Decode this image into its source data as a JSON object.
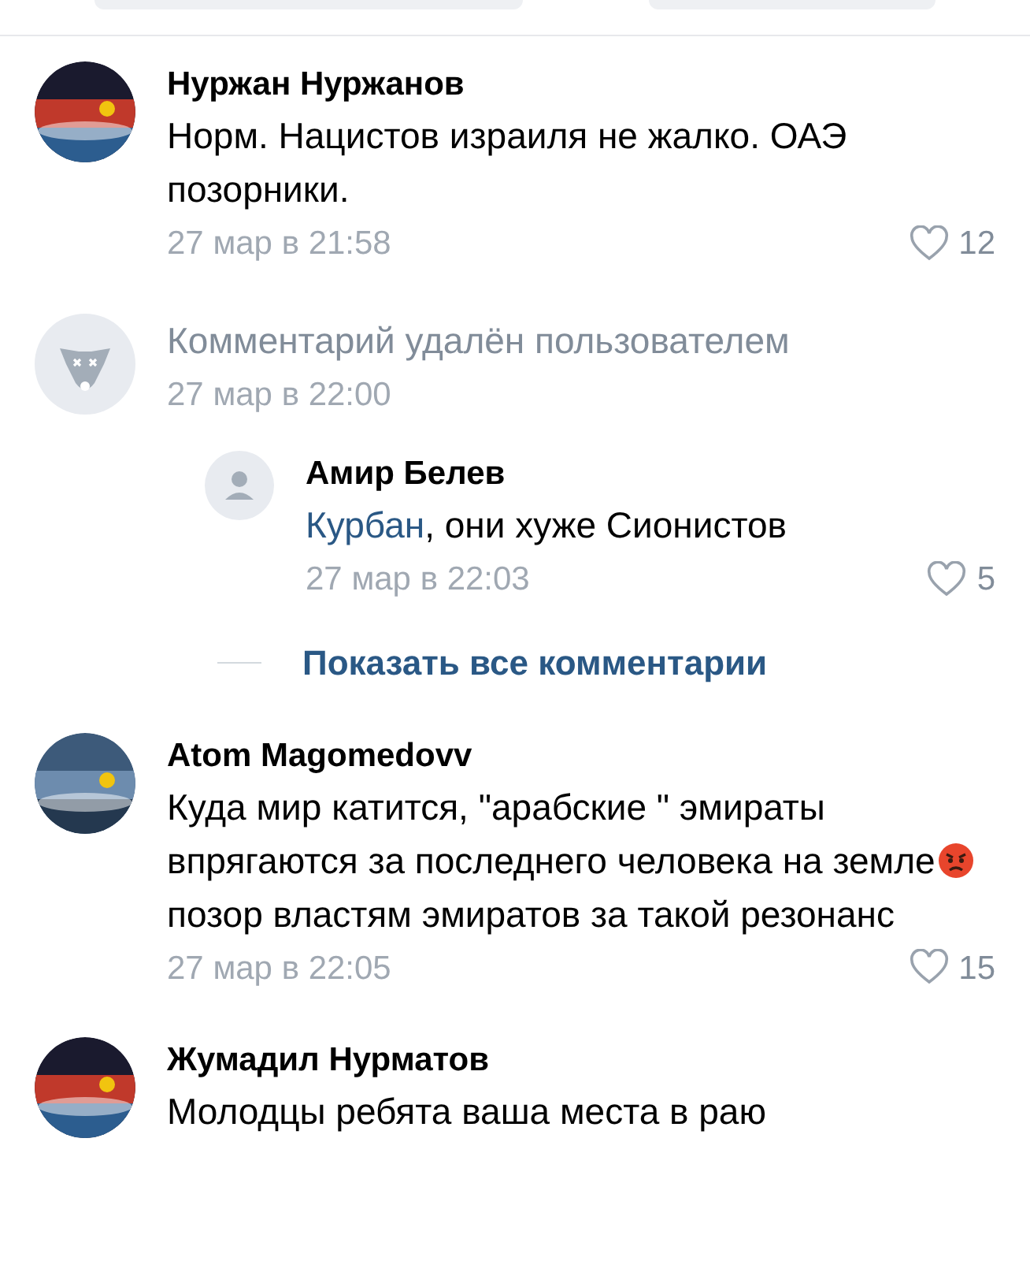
{
  "comments": [
    {
      "kind": "normal",
      "avatar": {
        "kind": "picture"
      },
      "author": "Нуржан Нуржанов",
      "body": [
        {
          "kind": "text",
          "text": "Норм. Нацистов израиля не жалко. ОАЭ позорники."
        }
      ],
      "date": "27 мар в 21:58",
      "likes": "12",
      "liked": false
    },
    {
      "kind": "deleted",
      "avatar": {
        "kind": "deleted"
      },
      "body": [
        {
          "kind": "text",
          "text": "Комментарий удалён пользователем"
        }
      ],
      "date": "27 мар в 22:00",
      "replies": [
        {
          "avatar": {
            "kind": "default"
          },
          "author": "Амир Белев",
          "mention": "Курбан",
          "body": [
            {
              "kind": "text",
              "text": ", они хуже Сионистов"
            }
          ],
          "date": "27 мар в 22:03",
          "likes": "5",
          "liked": false
        }
      ],
      "show_all": "Показать все комментарии"
    },
    {
      "kind": "normal",
      "avatar": {
        "kind": "picture"
      },
      "author": "Atom Magomedovv",
      "body": [
        {
          "kind": "text",
          "text": "Куда мир катится, \"арабские \" эмираты впрягаются за последнего человека на земле"
        },
        {
          "kind": "emoji"
        },
        {
          "kind": "text",
          "text": " позор властям эмиратов за такой резонанс"
        }
      ],
      "date": "27 мар в 22:05",
      "likes": "15",
      "liked": false
    },
    {
      "kind": "normal",
      "avatar": {
        "kind": "picture"
      },
      "author": "Жумадил Нурматов",
      "body": [
        {
          "kind": "text",
          "text": "Молодцы ребята ваша места в раю"
        }
      ]
    }
  ]
}
